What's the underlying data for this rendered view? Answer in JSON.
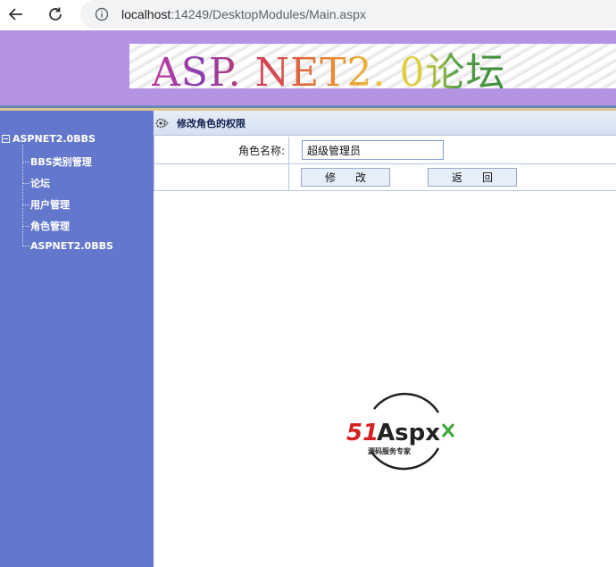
{
  "browser": {
    "url_host": "localhost",
    "url_rest": ":14249/DesktopModules/Main.aspx",
    "icons": [
      "back-arrow-icon",
      "reload-icon",
      "info-icon"
    ]
  },
  "banner": {
    "title": "ASP. NET2. 0论坛"
  },
  "sidebar": {
    "root": "ASPNET2.0BBS",
    "items": [
      {
        "label": "BBS类别管理"
      },
      {
        "label": "论坛"
      },
      {
        "label": "用户管理"
      },
      {
        "label": "角色管理"
      },
      {
        "label": "ASPNET2.0BBS"
      }
    ]
  },
  "content": {
    "title": "修改角色的权限",
    "form": {
      "role_name_label": "角色名称:",
      "role_name_value": "超级管理员",
      "modify_button": "修改",
      "back_button": "返回"
    }
  },
  "logo": {
    "brand": "51Aspx",
    "tagline": "源码服务专家"
  },
  "colors": {
    "banner_bg": "#b494e2",
    "sidebar_bg": "#6378cc",
    "title_bar_bg": "#dde6f5",
    "button_bg": "#e6eefa"
  }
}
